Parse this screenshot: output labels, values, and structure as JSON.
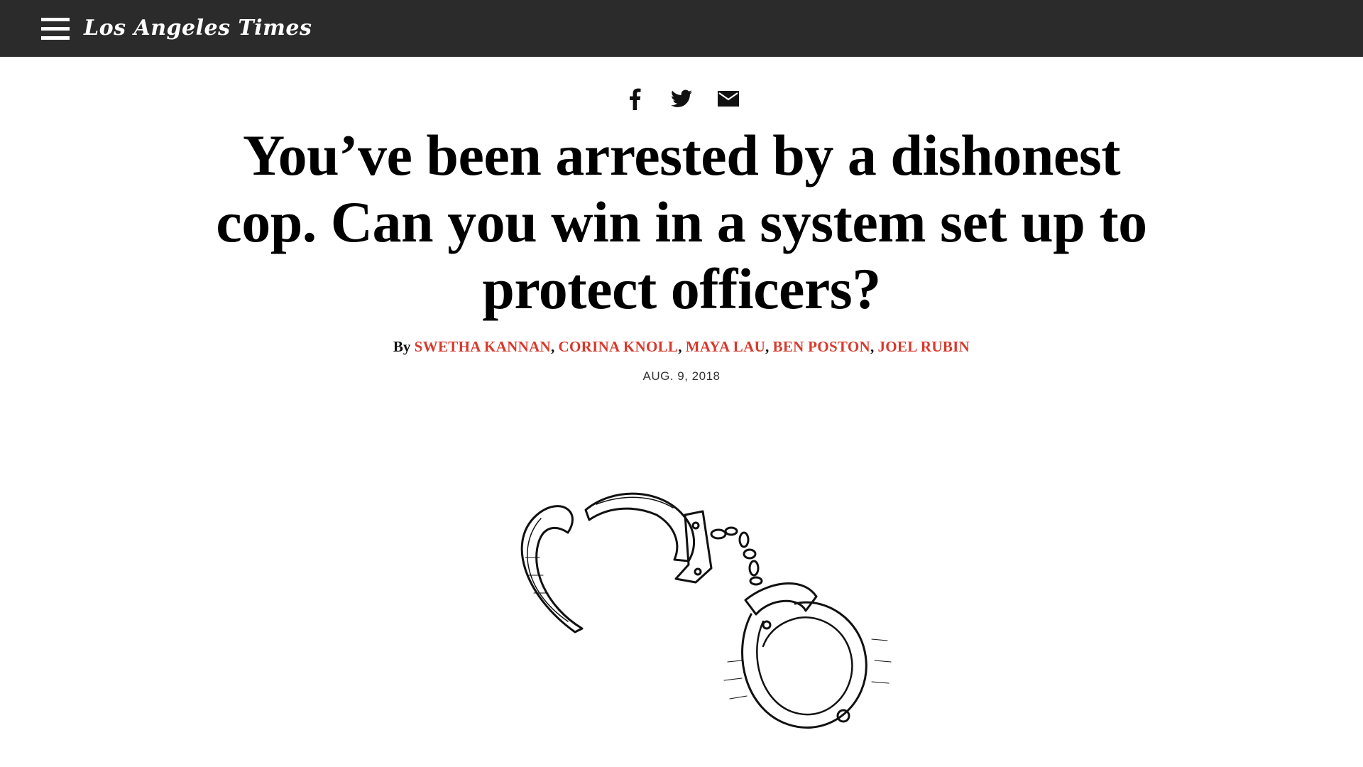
{
  "header": {
    "logo_text": "Los Angeles Times",
    "menu_icon": "hamburger-menu-icon",
    "background_color": "#2b2b2b"
  },
  "share": [
    {
      "icon": "facebook-icon"
    },
    {
      "icon": "twitter-icon"
    },
    {
      "icon": "email-icon"
    }
  ],
  "article": {
    "headline": "You’ve been arrested by a dishonest cop. Can you win in a system set up to protect officers?",
    "byline_prefix": "By",
    "authors": [
      "SWETHA KANNAN",
      "CORINA KNOLL",
      "MAYA LAU",
      "BEN POSTON",
      "JOEL RUBIN"
    ],
    "date": "AUG. 9, 2018",
    "author_link_color": "#d8392b"
  },
  "illustration": {
    "subject": "handcuffs-illustration"
  }
}
